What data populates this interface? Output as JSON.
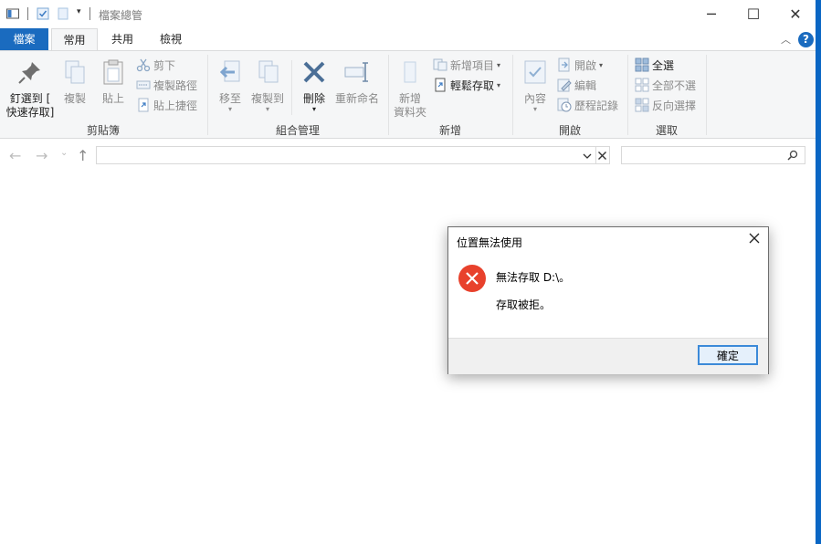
{
  "window": {
    "title": "檔案總管",
    "minimize_glyph": "─",
    "maximize_glyph": "☐",
    "close_glyph": "✕"
  },
  "tabs": [
    {
      "label": "檔案"
    },
    {
      "label": "常用"
    },
    {
      "label": "共用"
    },
    {
      "label": "檢視"
    }
  ],
  "ribbon": {
    "clipboard": {
      "label": "剪貼簿",
      "pin_line1": "釘選到 [",
      "pin_line2": "快速存取]",
      "copy": "複製",
      "paste": "貼上",
      "cut": "剪下",
      "copy_path": "複製路徑",
      "paste_shortcut": "貼上捷徑"
    },
    "organize": {
      "label": "組合管理",
      "move_to": "移至",
      "copy_to": "複製到",
      "delete": "刪除",
      "rename": "重新命名"
    },
    "new": {
      "label": "新增",
      "new_folder_line1": "新增",
      "new_folder_line2": "資料夾",
      "new_item": "新增項目",
      "easy_access": "輕鬆存取"
    },
    "open": {
      "label": "開啟",
      "properties": "內容",
      "open": "開啟",
      "edit": "編輯",
      "history": "歷程記錄"
    },
    "select": {
      "label": "選取",
      "select_all": "全選",
      "select_none": "全部不選",
      "invert": "反向選擇"
    }
  },
  "nav": {
    "back": "←",
    "forward": "→",
    "recent": "⌄",
    "up": "↑",
    "address_value": "",
    "search_placeholder": ""
  },
  "dialog": {
    "title": "位置無法使用",
    "message": "無法存取 D:\\。",
    "detail": "存取被拒。",
    "ok_label": "確定"
  },
  "colors": {
    "file_tab": "#1a6bbf",
    "error_icon": "#e8412c",
    "accent_edge": "#0a66c4"
  }
}
